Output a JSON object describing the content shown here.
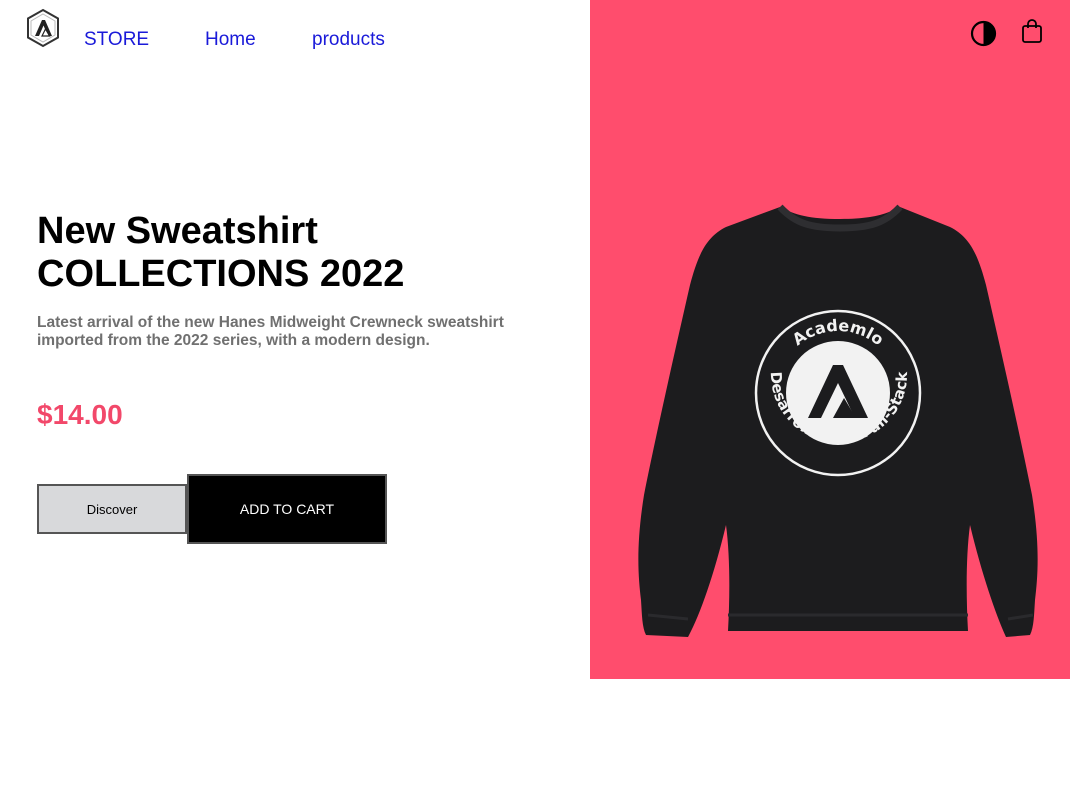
{
  "header": {
    "nav": {
      "store": "STORE",
      "home": "Home",
      "products": "products"
    },
    "logo_icon": "academlo-hexagon-logo",
    "theme_icon": "half-circle-contrast-icon",
    "cart_icon": "shopping-bag-icon"
  },
  "hero": {
    "title_line1": "New Sweatshirt",
    "title_line2": "COLLECTIONS 2022",
    "description": "Latest arrival of the new Hanes Midweight Crewneck sweatshirt imported from the 2022 series, with a modern design.",
    "price": "$14.00",
    "discover_label": "Discover",
    "add_to_cart_label": "ADD TO CART"
  },
  "product_image": {
    "badge_top_text": "Academlo",
    "badge_bottom_text": "Desarrollo Web Full-Stack"
  },
  "colors": {
    "accent": "#ff4d6d",
    "price": "#f2486a",
    "nav_link": "#1a1ad9"
  }
}
